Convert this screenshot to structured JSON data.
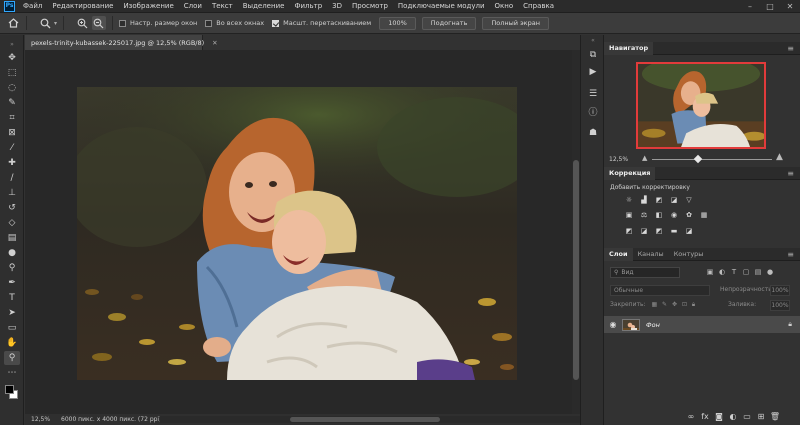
{
  "menu": {
    "app_icon": "Ps",
    "items": [
      "Файл",
      "Редактирование",
      "Изображение",
      "Слои",
      "Текст",
      "Выделение",
      "Фильтр",
      "3D",
      "Просмотр",
      "Подключаемые модули",
      "Окно",
      "Справка"
    ],
    "window_controls": [
      "minimize-icon",
      "maximize-icon",
      "close-icon"
    ]
  },
  "options": {
    "checkbox_resize": "Настр. размер окон",
    "checkbox_resize_checked": false,
    "checkbox_all_windows": "Во всех окнах",
    "checkbox_all_windows_checked": false,
    "checkbox_scrubby": "Масшт. перетаскиванием",
    "checkbox_scrubby_checked": true,
    "btn_100": "100%",
    "btn_fit": "Подогнать",
    "btn_fill": "Полный экран"
  },
  "document": {
    "tab_title": "pexels-trinity-kubassek-225017.jpg @ 12,5% (RGB/8)",
    "zoom": "12,5%",
    "info": "6000 пикс. x 4000 пикс. (72 ppi)"
  },
  "navigator": {
    "title": "Навигатор",
    "zoom": "12,5%",
    "zoom_level": 0.45
  },
  "adjustments": {
    "title": "Коррекция",
    "add_label": "Добавить корректировку"
  },
  "layers": {
    "tabs": [
      "Слои",
      "Каналы",
      "Контуры"
    ],
    "filter_placeholder": "Вид",
    "blend_mode": "Обычные",
    "opacity_label": "Непрозрачность:",
    "opacity_value": "100%",
    "lock_label": "Закрепить:",
    "fill_label": "Заливка:",
    "fill_value": "100%",
    "items": [
      {
        "name": "Фон",
        "visible": true,
        "locked": true
      }
    ]
  },
  "colors": {
    "accent": "#31a8ff",
    "nav_frame": "#e23b3b"
  }
}
